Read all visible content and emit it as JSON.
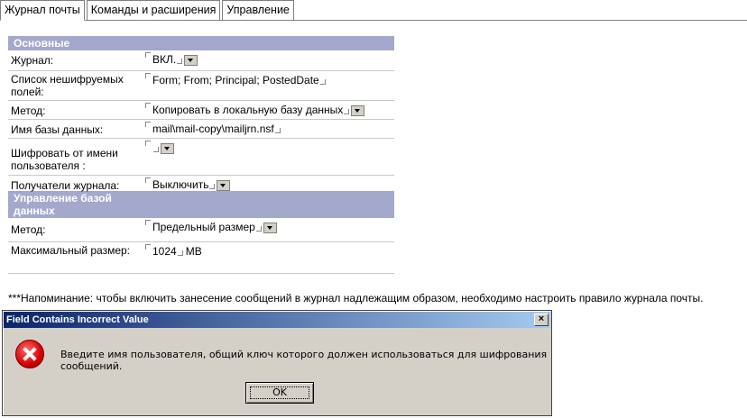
{
  "tabs": [
    "Журнал почты",
    "Команды и расширения",
    "Управление"
  ],
  "sections": {
    "basic": "Основные",
    "db": "Управление базой данных"
  },
  "fields": {
    "journal": {
      "label": "Журнал:",
      "value": "ВКЛ."
    },
    "unencrypted": {
      "label": "Список нешифруемых полей:",
      "value": "Form; From; Principal; PostedDate"
    },
    "method": {
      "label": "Метод:",
      "value": "Копировать в локальную базу данных"
    },
    "dbname": {
      "label": "Имя базы данных:",
      "value": "mail\\mail-copy\\mailjrn.nsf"
    },
    "encrypt_user": {
      "label": "Шифровать от имени пользователя :",
      "value": ""
    },
    "recipients": {
      "label": "Получатели журнала:",
      "value": "Выключить"
    },
    "db_method": {
      "label": "Метод:",
      "value": "Предельный размер"
    },
    "max_size": {
      "label": "Максимальный размер:",
      "value": "1024",
      "unit": "MB"
    }
  },
  "note": "***Напоминание:   чтобы включить занесение сообщений в журнал надлежащим образом, необходимо настроить правило журнала почты.",
  "dialog": {
    "title": "Field Contains Incorrect Value",
    "close": "×",
    "message": "Введите имя пользователя, общий ключ которого должен использоваться для шифрования сообщений.",
    "ok": "OK"
  }
}
